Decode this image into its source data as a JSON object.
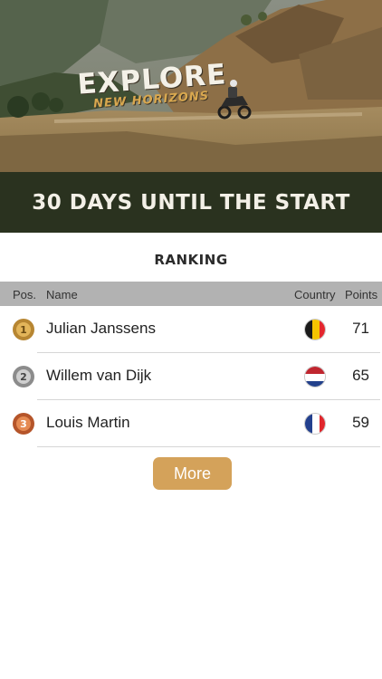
{
  "hero": {
    "logo_main": "EXPLORE",
    "logo_sub": "NEW HORIZONS"
  },
  "countdown": {
    "text": "30 DAYS UNTIL THE START"
  },
  "ranking": {
    "title": "RANKING",
    "columns": {
      "pos": "Pos.",
      "name": "Name",
      "country": "Country",
      "points": "Points"
    },
    "rows": [
      {
        "position": "1",
        "name": "Julian Janssens",
        "country": "Belgium",
        "flag_colors": [
          "#1a1a1a",
          "#f5c400",
          "#e4262c"
        ],
        "points": "71",
        "medal_color": "#c9963a"
      },
      {
        "position": "2",
        "name": "Willem van Dijk",
        "country": "Netherlands",
        "flag_colors": [
          "#c0262f",
          "#ffffff",
          "#22408b"
        ],
        "points": "65",
        "medal_color": "#9a9a9a"
      },
      {
        "position": "3",
        "name": "Louis Martin",
        "country": "France",
        "flag_colors": [
          "#23408e",
          "#ffffff",
          "#e0262c"
        ],
        "points": "59",
        "medal_color": "#c2602e"
      }
    ]
  },
  "more_button": {
    "label": "More"
  },
  "colors": {
    "countdown_bg": "#2a321f",
    "header_bg": "#b2b2b2",
    "accent": "#d4a25a"
  }
}
